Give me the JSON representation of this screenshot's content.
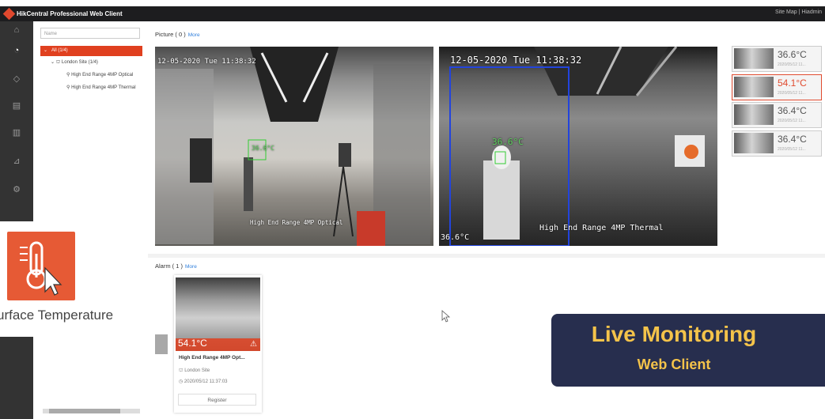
{
  "titlebar": {
    "title": "HikCentral Professional Web Client",
    "right": "Site Map  |  Hiadmin"
  },
  "tree": {
    "search_placeholder": "Name",
    "root": "All (1/4)",
    "site": "London Site (1/4)",
    "cameras": [
      "High End Range 4MP Optical",
      "High End Range 4MP Thermal"
    ]
  },
  "picture": {
    "label": "Picture ( 0 )",
    "more": "More"
  },
  "cameras": {
    "optical": {
      "timestamp": "12-05-2020 Tue 11:38:32",
      "channel": "High End Range 4MP Optical",
      "temp": "36.6°C"
    },
    "thermal": {
      "timestamp": "12-05-2020 Tue 11:38:32",
      "channel": "High End Range 4MP Thermal",
      "temp_face": "36.6°C",
      "temp_corner": "36.6°C"
    }
  },
  "thumbnails": [
    {
      "temp": "36.6°C",
      "date": "2020/05/12 11...",
      "alarm": false
    },
    {
      "temp": "54.1°C",
      "date": "2020/05/12 11...",
      "alarm": true
    },
    {
      "temp": "36.4°C",
      "date": "2020/05/12 11...",
      "alarm": false
    },
    {
      "temp": "36.4°C",
      "date": "2020/05/12 11...",
      "alarm": false
    }
  ],
  "alarm": {
    "label": "Alarm ( 1 )",
    "more": "More",
    "card": {
      "temp": "54.1°C",
      "name": "High End Range 4MP Opt...",
      "site": "London Site",
      "time": "2020/05/12 11:37:03",
      "register": "Register"
    }
  },
  "feature": {
    "label": "urface Temperature"
  },
  "badge": {
    "title": "Live Monitoring",
    "subtitle": "Web Client"
  },
  "colors": {
    "accent": "#e0401f",
    "frame": "#e3792b",
    "badge_bg": "#272e4e",
    "badge_text": "#f4c34a"
  }
}
